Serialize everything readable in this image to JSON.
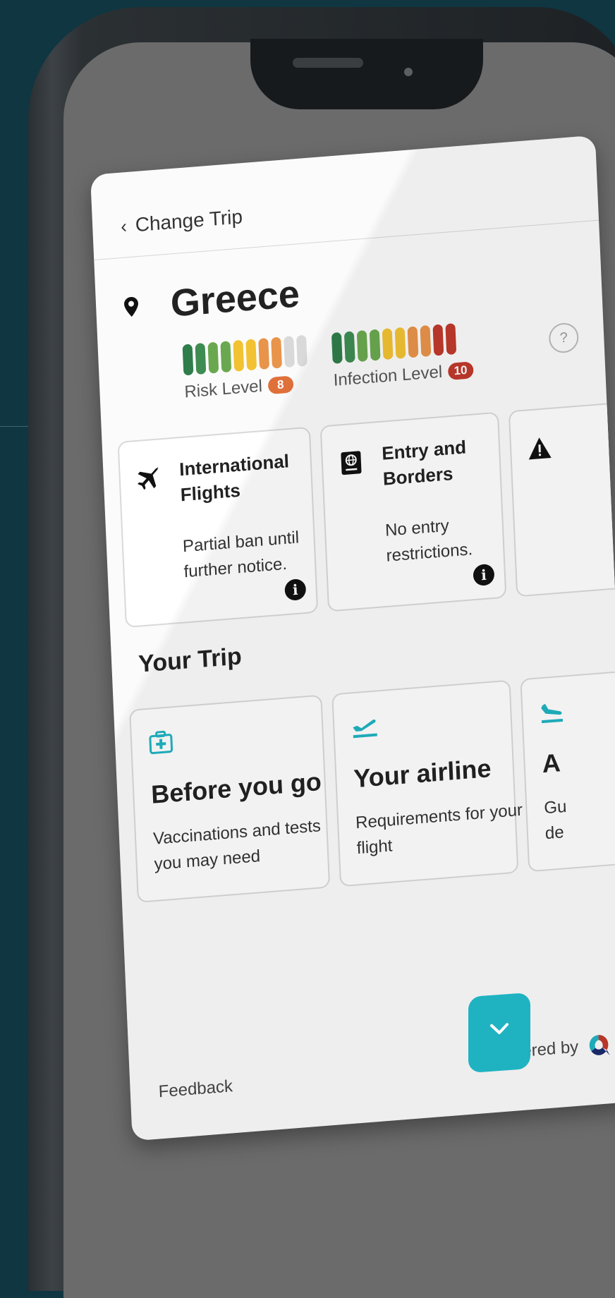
{
  "header": {
    "back_label": "Change Trip"
  },
  "country": {
    "name": "Greece"
  },
  "risk": {
    "label": "Risk Level",
    "value": "8",
    "badge_color": "#e0703a",
    "bars": [
      "#2f7d4b",
      "#3e8c52",
      "#6aa84f",
      "#6aa84f",
      "#f2c232",
      "#f2c232",
      "#e8944a",
      "#e8944a",
      "#d9d9d9",
      "#d9d9d9"
    ]
  },
  "infection": {
    "label": "Infection Level",
    "value": "10",
    "badge_color": "#c0392b",
    "bars": [
      "#2f7d4b",
      "#3e8c52",
      "#6aa84f",
      "#6aa84f",
      "#f2c232",
      "#f2c232",
      "#e8944a",
      "#e8944a",
      "#c0392b",
      "#c0392b"
    ]
  },
  "help_symbol": "?",
  "info_cards": [
    {
      "icon": "airplane-icon",
      "title": "International Flights",
      "desc": "Partial ban until further notice.",
      "info_symbol": "i"
    },
    {
      "icon": "passport-icon",
      "title": "Entry and Borders",
      "desc": "No entry restrictions.",
      "info_symbol": "i"
    },
    {
      "icon": "warning-icon",
      "title": "",
      "desc": "",
      "info_symbol": ""
    }
  ],
  "trip": {
    "section_title": "Your Trip",
    "cards": [
      {
        "icon": "medical-bag-icon",
        "title": "Before you go",
        "desc": "Vaccinations and tests you may need"
      },
      {
        "icon": "departure-icon",
        "title": "Your airline",
        "desc": "Requirements for your flight"
      },
      {
        "icon": "arrival-icon",
        "title": "A",
        "desc": "Gu de"
      }
    ]
  },
  "footer": {
    "feedback": "Feedback",
    "powered_by": "Powered by"
  },
  "colors": {
    "accent": "#1fb3c2",
    "background": "#0f3641"
  }
}
